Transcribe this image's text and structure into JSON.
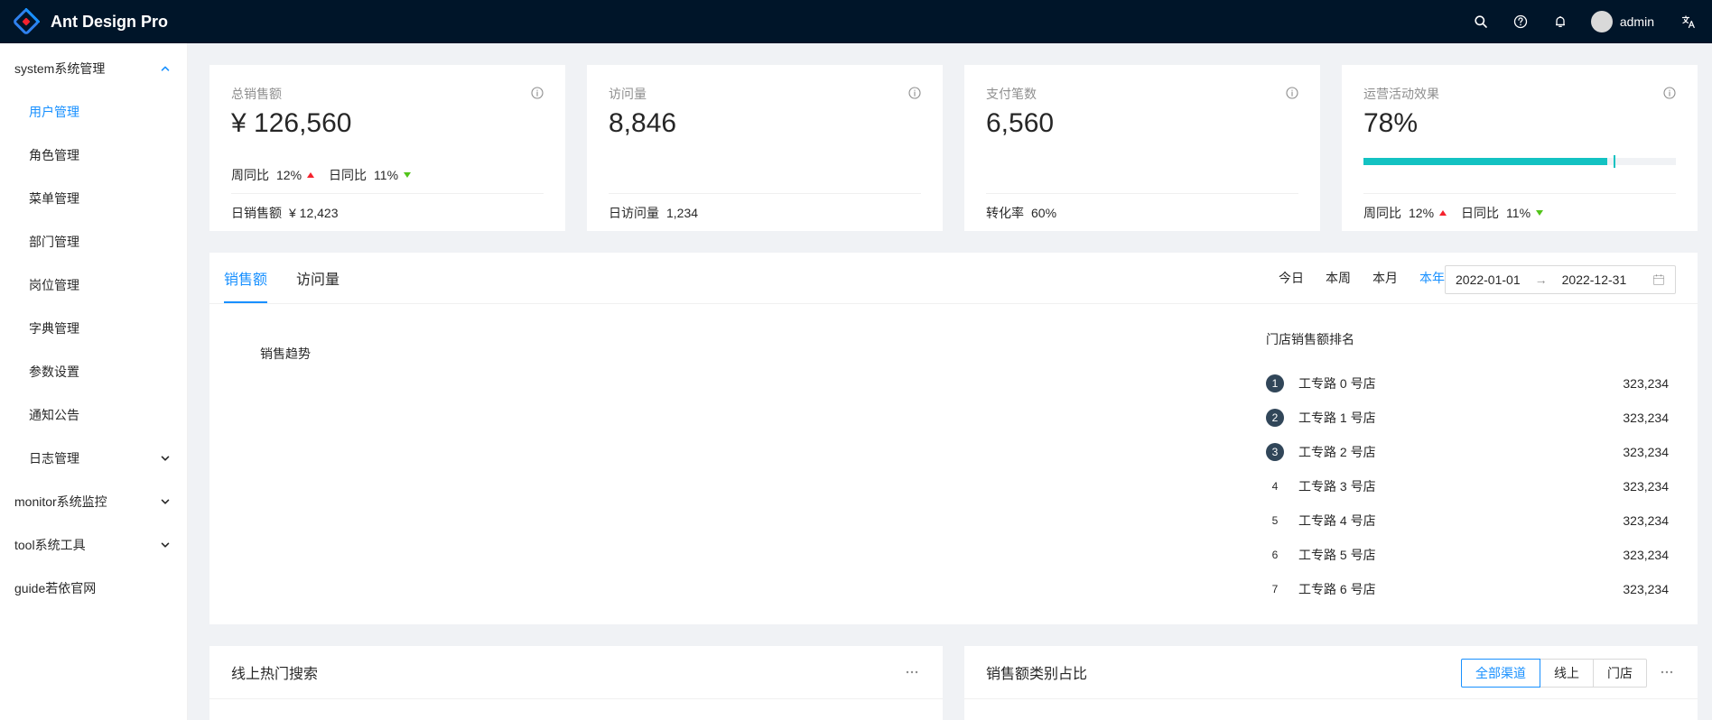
{
  "header": {
    "title": "Ant Design Pro",
    "username": "admin",
    "icons": [
      "search-icon",
      "question-icon",
      "bell-icon",
      "translate-icon"
    ],
    "bg_color": "#001529"
  },
  "sidebar": {
    "items": [
      {
        "label": "system系统管理",
        "level": "root",
        "expanded": true
      },
      {
        "label": "用户管理",
        "level": "child",
        "active": true
      },
      {
        "label": "角色管理",
        "level": "child"
      },
      {
        "label": "菜单管理",
        "level": "child"
      },
      {
        "label": "部门管理",
        "level": "child"
      },
      {
        "label": "岗位管理",
        "level": "child"
      },
      {
        "label": "字典管理",
        "level": "child"
      },
      {
        "label": "参数设置",
        "level": "child"
      },
      {
        "label": "通知公告",
        "level": "child"
      },
      {
        "label": "日志管理",
        "level": "child",
        "expandable": true
      },
      {
        "label": "monitor系统监控",
        "level": "root",
        "expandable": true
      },
      {
        "label": "tool系统工具",
        "level": "root",
        "expandable": true
      },
      {
        "label": "guide若依官网",
        "level": "root"
      }
    ]
  },
  "stats": [
    {
      "title": "总销售额",
      "value": "¥ 126,560",
      "week_label": "周同比",
      "week_value": "12%",
      "day_label": "日同比",
      "day_value": "11%",
      "footer_label": "日销售额",
      "footer_value": "¥ 12,423"
    },
    {
      "title": "访问量",
      "value": "8,846",
      "footer_label": "日访问量",
      "footer_value": "1,234"
    },
    {
      "title": "支付笔数",
      "value": "6,560",
      "footer_label": "转化率",
      "footer_value": "60%"
    },
    {
      "title": "运营活动效果",
      "value": "78%",
      "progress_percent": 78,
      "progress_target_percent": 80,
      "week_label": "周同比",
      "week_value": "12%",
      "day_label": "日同比",
      "day_value": "11%"
    }
  ],
  "sales": {
    "tabs": [
      "销售额",
      "访问量"
    ],
    "active_tab": 0,
    "range_links": [
      "今日",
      "本周",
      "本月",
      "本年"
    ],
    "active_range": 3,
    "date_start": "2022-01-01",
    "date_end": "2022-12-31",
    "chart_title": "销售趋势",
    "ranking_title": "门店销售额排名",
    "ranking": [
      {
        "rank": "1",
        "name": "工专路 0 号店",
        "value": "323,234"
      },
      {
        "rank": "2",
        "name": "工专路 1 号店",
        "value": "323,234"
      },
      {
        "rank": "3",
        "name": "工专路 2 号店",
        "value": "323,234"
      },
      {
        "rank": "4",
        "name": "工专路 3 号店",
        "value": "323,234"
      },
      {
        "rank": "5",
        "name": "工专路 4 号店",
        "value": "323,234"
      },
      {
        "rank": "6",
        "name": "工专路 5 号店",
        "value": "323,234"
      },
      {
        "rank": "7",
        "name": "工专路 6 号店",
        "value": "323,234"
      }
    ]
  },
  "hot_search": {
    "title": "线上热门搜索"
  },
  "category": {
    "title": "销售额类别占比",
    "options": [
      "全部渠道",
      "线上",
      "门店"
    ],
    "active_option": 0
  },
  "colors": {
    "accent": "#1890ff",
    "progress": "#13c2c2",
    "up": "#f5222d",
    "down": "#52c41a",
    "rank_badge": "#314659"
  }
}
